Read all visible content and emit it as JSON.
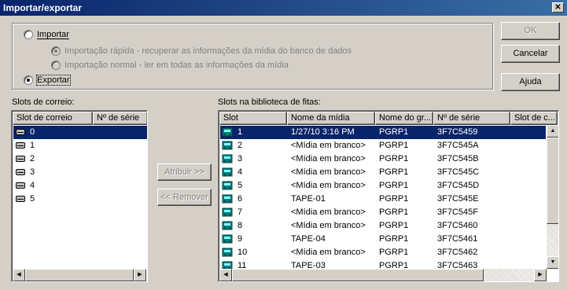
{
  "window": {
    "title": "Importar/exportar",
    "close_glyph": "✕"
  },
  "mode": {
    "import_label": "Importar",
    "fast_label": "Importação rápida - recuperar as informações da mídia do banco de dados",
    "normal_label": "Importação normal - ler em todas as informações da mídia",
    "export_label": "Exportar",
    "selected": "export"
  },
  "buttons": {
    "ok": "OK",
    "cancel": "Cancelar",
    "help": "Ajuda",
    "assign": "Atribuir >>",
    "remove": "<< Remover"
  },
  "mail_slots": {
    "label": "Slots de correio:",
    "columns": [
      "Slot de correio",
      "Nº de série"
    ],
    "rows": [
      {
        "slot": "0",
        "serial": ""
      },
      {
        "slot": "1",
        "serial": ""
      },
      {
        "slot": "2",
        "serial": ""
      },
      {
        "slot": "3",
        "serial": ""
      },
      {
        "slot": "4",
        "serial": ""
      },
      {
        "slot": "5",
        "serial": ""
      }
    ],
    "selected_index": 0
  },
  "library": {
    "label": "Slots na biblioteca de fitas:",
    "columns": [
      "Slot",
      "Nome da mídia",
      "Nome do gr...",
      "Nº de série",
      "Slot de c..."
    ],
    "rows": [
      {
        "slot": "1",
        "media": "1/27/10 3:16 PM",
        "group": "PGRP1",
        "serial": "3F7C5459"
      },
      {
        "slot": "2",
        "media": "<Mídia em branco>",
        "group": "PGRP1",
        "serial": "3F7C545A"
      },
      {
        "slot": "3",
        "media": "<Mídia em branco>",
        "group": "PGRP1",
        "serial": "3F7C545B"
      },
      {
        "slot": "4",
        "media": "<Mídia em branco>",
        "group": "PGRP1",
        "serial": "3F7C545C"
      },
      {
        "slot": "5",
        "media": "<Mídia em branco>",
        "group": "PGRP1",
        "serial": "3F7C545D"
      },
      {
        "slot": "6",
        "media": "TAPE-01",
        "group": "PGRP1",
        "serial": "3F7C545E"
      },
      {
        "slot": "7",
        "media": "<Mídia em branco>",
        "group": "PGRP1",
        "serial": "3F7C545F"
      },
      {
        "slot": "8",
        "media": "<Mídia em branco>",
        "group": "PGRP1",
        "serial": "3F7C5460"
      },
      {
        "slot": "9",
        "media": "TAPE-04",
        "group": "PGRP1",
        "serial": "3F7C5461"
      },
      {
        "slot": "10",
        "media": "<Mídia em branco>",
        "group": "PGRP1",
        "serial": "3F7C5462"
      },
      {
        "slot": "11",
        "media": "TAPE-03",
        "group": "PGRP1",
        "serial": "3F7C5463"
      }
    ],
    "selected_index": 0
  },
  "icons": {
    "mail_slot": "drive-slot-icon",
    "tape": "tape-cartridge-icon"
  },
  "colors": {
    "selection": "#0a246a",
    "face": "#d4d0c8",
    "tape_icon": "#008080"
  }
}
